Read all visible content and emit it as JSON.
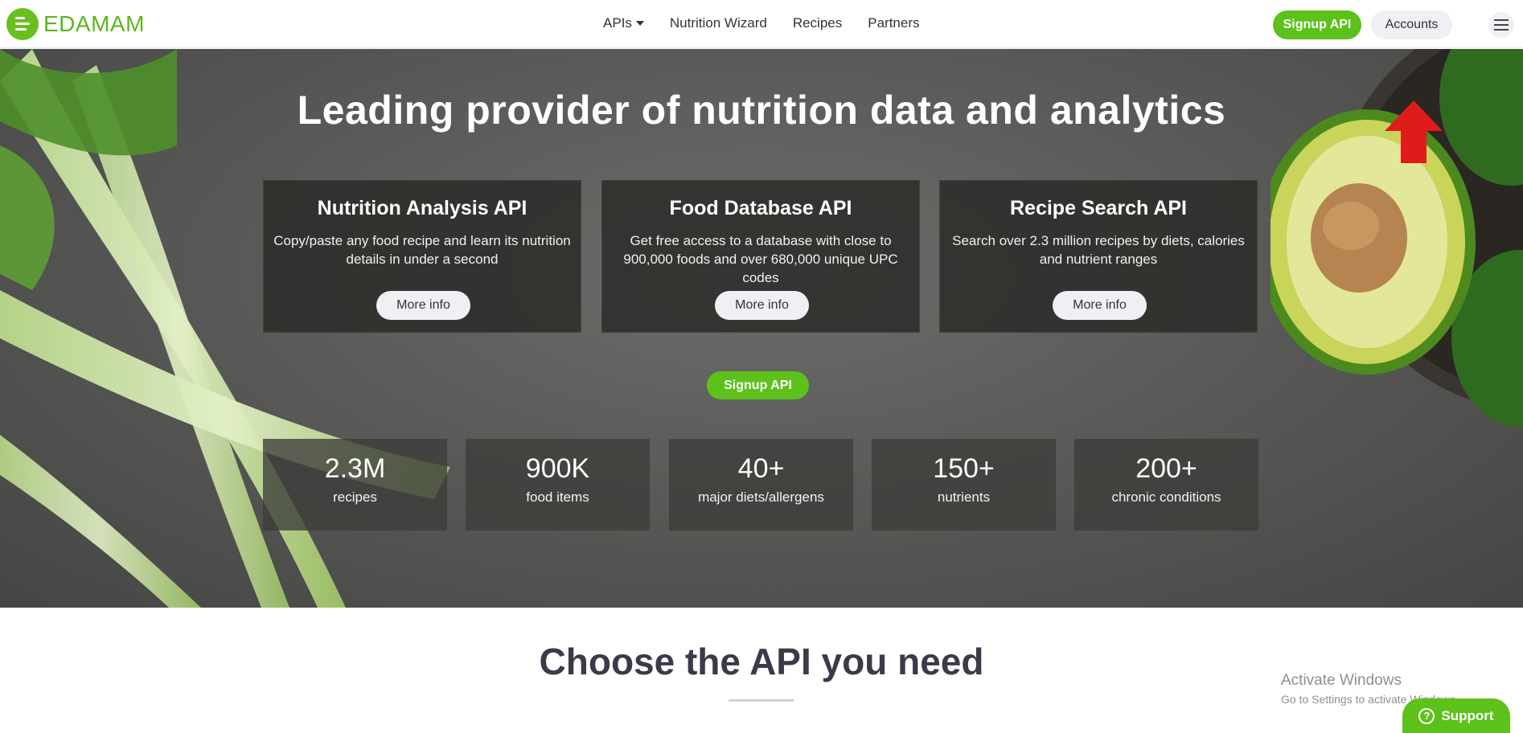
{
  "header": {
    "logo_text": "EDAMAM",
    "nav": [
      {
        "label": "APIs",
        "has_dropdown": true
      },
      {
        "label": "Nutrition Wizard"
      },
      {
        "label": "Recipes"
      },
      {
        "label": "Partners"
      }
    ],
    "signup_label": "Signup API",
    "accounts_label": "Accounts",
    "menu_icon": "hamburger-icon"
  },
  "hero": {
    "title": "Leading provider of nutrition data and analytics",
    "cards": [
      {
        "title": "Nutrition Analysis API",
        "desc": "Copy/paste any food recipe and learn its nutrition details in under a second",
        "button": "More info"
      },
      {
        "title": "Food Database API",
        "desc": "Get free access to a database with close to 900,000 foods and over 680,000 unique UPC codes",
        "button": "More info"
      },
      {
        "title": "Recipe Search API",
        "desc": "Search over 2.3 million recipes by diets, calories and nutrient ranges",
        "button": "More info"
      }
    ],
    "signup_label": "Signup API",
    "stats": [
      {
        "value": "2.3M",
        "label": "recipes"
      },
      {
        "value": "900K",
        "label": "food items"
      },
      {
        "value": "40+",
        "label": "major diets/allergens"
      },
      {
        "value": "150+",
        "label": "nutrients"
      },
      {
        "value": "200+",
        "label": "chronic conditions"
      }
    ]
  },
  "section": {
    "title": "Choose the API you need"
  },
  "overlay": {
    "activate_title": "Activate Windows",
    "activate_sub": "Go to Settings to activate Windows.",
    "support_label": "Support"
  },
  "colors": {
    "brand_green": "#5cc11b",
    "annotation_arrow": "#e01b1b"
  }
}
